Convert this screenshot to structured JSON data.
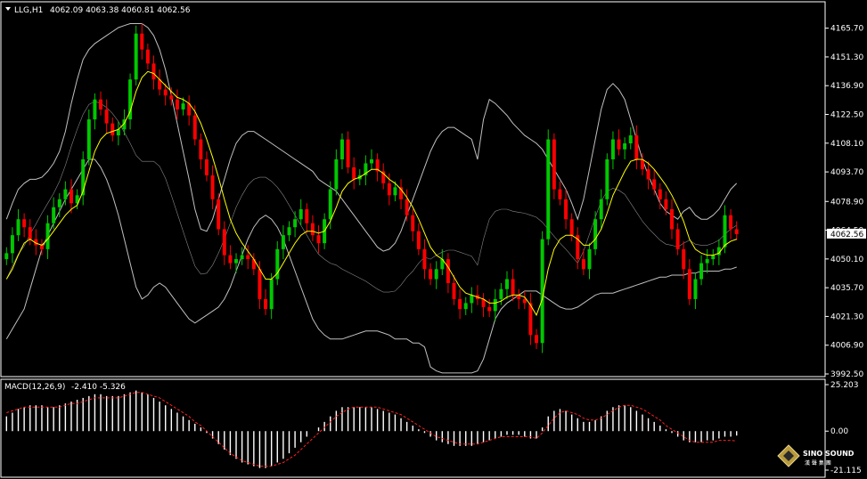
{
  "header": {
    "symbol": "LLG,H1",
    "ohlc": "4062.09 4063.38 4060.81 4062.56"
  },
  "macd_header": {
    "label": "MACD(12,26,9)",
    "values": "-2.410 -5.326"
  },
  "watermark": {
    "brand": "SINO SOUND",
    "sub": "漢 聲 集 團"
  },
  "colors": {
    "background": "#000000",
    "up_candle": "#00c800",
    "down_candle": "#ff0000",
    "ma": "#ffff00",
    "bollinger": "#c0c0c0",
    "macd_hist": "#ffffff",
    "macd_signal": "#ff2020",
    "axis_text": "#ffffff",
    "price_tag_bg": "#ffffff",
    "price_tag_text": "#000000"
  },
  "chart_data": [
    {
      "type": "candlestick",
      "title": "LLG,H1",
      "current_price": "4062.56",
      "ylim": [
        3992.5,
        4170
      ],
      "y_ticks": [
        "4165.70",
        "4151.30",
        "4136.90",
        "4122.50",
        "4108.10",
        "4093.70",
        "4078.90",
        "4064.50",
        "4050.10",
        "4035.70",
        "4021.30",
        "4006.90",
        "3992.50"
      ],
      "close": [
        4053,
        4062,
        4070,
        4066,
        4060,
        4057,
        4055,
        4068,
        4076,
        4080,
        4085,
        4078,
        4082,
        4100,
        4120,
        4130,
        4125,
        4118,
        4112,
        4115,
        4120,
        4140,
        4163,
        4155,
        4148,
        4140,
        4135,
        4132,
        4130,
        4125,
        4128,
        4122,
        4110,
        4100,
        4092,
        4080,
        4065,
        4052,
        4048,
        4050,
        4052,
        4050,
        4045,
        4030,
        4025,
        4040,
        4055,
        4062,
        4066,
        4070,
        4075,
        4068,
        4062,
        4058,
        4070,
        4085,
        4100,
        4110,
        4096,
        4090,
        4092,
        4098,
        4100,
        4094,
        4088,
        4082,
        4086,
        4080,
        4072,
        4064,
        4055,
        4045,
        4040,
        4045,
        4050,
        4038,
        4030,
        4025,
        4028,
        4032,
        4030,
        4026,
        4024,
        4030,
        4035,
        4040,
        4032,
        4030,
        4028,
        4012,
        4008,
        4060,
        4110,
        4085,
        4080,
        4070,
        4062,
        4050,
        4045,
        4055,
        4070,
        4080,
        4100,
        4110,
        4105,
        4108,
        4112,
        4100,
        4095,
        4090,
        4085,
        4080,
        4075,
        4065,
        4055,
        4045,
        4030,
        4040,
        4048,
        4050,
        4052,
        4056,
        4072,
        4065,
        4062.56
      ],
      "ma": [
        4040,
        4045,
        4052,
        4058,
        4060,
        4058,
        4057,
        4060,
        4064,
        4068,
        4072,
        4075,
        4077,
        4084,
        4094,
        4104,
        4110,
        4113,
        4114,
        4115,
        4118,
        4124,
        4134,
        4141,
        4144,
        4143,
        4140,
        4137,
        4134,
        4131,
        4130,
        4128,
        4124,
        4118,
        4110,
        4101,
        4091,
        4080,
        4070,
        4063,
        4058,
        4054,
        4050,
        4045,
        4040,
        4040,
        4043,
        4048,
        4053,
        4058,
        4062,
        4064,
        4064,
        4063,
        4064,
        4069,
        4076,
        4084,
        4088,
        4090,
        4091,
        4093,
        4095,
        4095,
        4093,
        4090,
        4088,
        4085,
        4081,
        4076,
        4070,
        4063,
        4056,
        4052,
        4050,
        4046,
        4041,
        4036,
        4033,
        4032,
        4031,
        4030,
        4028,
        4028,
        4029,
        4031,
        4032,
        4032,
        4031,
        4027,
        4022,
        4030,
        4045,
        4055,
        4060,
        4062,
        4062,
        4060,
        4057,
        4057,
        4060,
        4065,
        4073,
        4082,
        4088,
        4094,
        4099,
        4100,
        4100,
        4098,
        4095,
        4091,
        4087,
        4082,
        4076,
        4069,
        4060,
        4055,
        4053,
        4052,
        4052,
        4053,
        4057,
        4059,
        4060
      ],
      "bb_upper": [
        4070,
        4078,
        4085,
        4088,
        4090,
        4090,
        4091,
        4094,
        4098,
        4104,
        4114,
        4128,
        4140,
        4150,
        4155,
        4158,
        4160,
        4162,
        4164,
        4166,
        4167,
        4168,
        4168,
        4168,
        4166,
        4162,
        4155,
        4145,
        4132,
        4118,
        4104,
        4090,
        4075,
        4065,
        4064,
        4070,
        4080,
        4090,
        4100,
        4108,
        4112,
        4114,
        4114,
        4112,
        4110,
        4108,
        4106,
        4104,
        4102,
        4100,
        4098,
        4096,
        4094,
        4090,
        4088,
        4086,
        4084,
        4080,
        4076,
        4072,
        4068,
        4064,
        4060,
        4056,
        4054,
        4055,
        4058,
        4064,
        4072,
        4080,
        4088,
        4096,
        4104,
        4110,
        4114,
        4116,
        4116,
        4114,
        4112,
        4110,
        4100,
        4120,
        4130,
        4128,
        4125,
        4122,
        4118,
        4115,
        4112,
        4110,
        4108,
        4105,
        4100,
        4095,
        4090,
        4085,
        4078,
        4070,
        4080,
        4095,
        4110,
        4125,
        4135,
        4138,
        4135,
        4130,
        4120,
        4110,
        4100,
        4092,
        4085,
        4078,
        4074,
        4072,
        4070,
        4074,
        4076,
        4072,
        4070,
        4070,
        4072,
        4075,
        4080,
        4085,
        4088
      ],
      "bb_lower": [
        4010,
        4015,
        4020,
        4025,
        4035,
        4045,
        4055,
        4062,
        4068,
        4074,
        4080,
        4085,
        4090,
        4095,
        4100,
        4100,
        4096,
        4090,
        4082,
        4072,
        4060,
        4048,
        4036,
        4030,
        4032,
        4036,
        4038,
        4036,
        4032,
        4028,
        4024,
        4020,
        4018,
        4020,
        4022,
        4024,
        4026,
        4030,
        4036,
        4044,
        4052,
        4060,
        4066,
        4070,
        4072,
        4070,
        4066,
        4060,
        4052,
        4044,
        4036,
        4028,
        4020,
        4015,
        4012,
        4010,
        4010,
        4010,
        4011,
        4012,
        4013,
        4014,
        4014,
        4014,
        4013,
        4012,
        4010,
        4010,
        4010,
        4008,
        4008,
        4006,
        3996,
        3994,
        3993,
        3993,
        3993,
        3993,
        3993,
        3993,
        3994,
        4000,
        4010,
        4020,
        4025,
        4028,
        4030,
        4032,
        4034,
        4034,
        4034,
        4032,
        4030,
        4028,
        4026,
        4025,
        4025,
        4026,
        4028,
        4030,
        4032,
        4033,
        4033,
        4033,
        4034,
        4035,
        4036,
        4037,
        4038,
        4039,
        4040,
        4041,
        4041,
        4042,
        4042,
        4042,
        4043,
        4043,
        4044,
        4044,
        4044,
        4044,
        4045,
        4045,
        4046
      ]
    },
    {
      "type": "bar",
      "title": "MACD(12,26,9)",
      "y_ticks": [
        "25.203",
        "0.00",
        "-21.115"
      ],
      "ylim": [
        -21.115,
        25.203
      ],
      "histogram": [
        8,
        10,
        12,
        13,
        14,
        14,
        14,
        13,
        13,
        14,
        15,
        16,
        17,
        18,
        19,
        20,
        20,
        19,
        19,
        19,
        20,
        21,
        22,
        21,
        20,
        18,
        16,
        14,
        12,
        10,
        8,
        6,
        4,
        2,
        -1,
        -4,
        -7,
        -10,
        -13,
        -15,
        -17,
        -18,
        -19,
        -20,
        -20,
        -19,
        -17,
        -15,
        -12,
        -9,
        -6,
        -3,
        0,
        2,
        5,
        8,
        11,
        13,
        13,
        13,
        13,
        13,
        13,
        12,
        11,
        10,
        9,
        7,
        5,
        3,
        1,
        -1,
        -3,
        -5,
        -6,
        -7,
        -8,
        -8,
        -8,
        -8,
        -7,
        -6,
        -5,
        -4,
        -3,
        -2,
        -2,
        -2,
        -3,
        -4,
        -4,
        2,
        8,
        11,
        12,
        11,
        9,
        7,
        5,
        5,
        6,
        8,
        11,
        13,
        14,
        14,
        13,
        11,
        9,
        7,
        5,
        3,
        1,
        -1,
        -3,
        -5,
        -6,
        -6,
        -6,
        -5,
        -5,
        -4,
        -3,
        -3,
        -2.41
      ],
      "signal": [
        10,
        11,
        12,
        13,
        13,
        13,
        13,
        13,
        13,
        13,
        14,
        15,
        15,
        16,
        17,
        18,
        18,
        18,
        18,
        18,
        19,
        20,
        21,
        21,
        20,
        19,
        18,
        16,
        14,
        12,
        10,
        8,
        5,
        3,
        0,
        -3,
        -6,
        -9,
        -12,
        -14,
        -16,
        -17,
        -18,
        -19,
        -19,
        -19,
        -18,
        -17,
        -15,
        -13,
        -10,
        -7,
        -4,
        -1,
        2,
        5,
        8,
        10,
        12,
        13,
        13,
        13,
        13,
        13,
        12,
        11,
        10,
        9,
        7,
        5,
        3,
        1,
        -1,
        -3,
        -4,
        -5,
        -6,
        -7,
        -7,
        -7,
        -7,
        -6,
        -5,
        -4,
        -3,
        -3,
        -3,
        -3,
        -3,
        -3,
        -4,
        -1,
        3,
        7,
        10,
        11,
        10,
        9,
        7,
        6,
        6,
        7,
        9,
        11,
        13,
        14,
        14,
        13,
        12,
        10,
        8,
        6,
        3,
        1,
        -1,
        -3,
        -5,
        -6,
        -6,
        -6,
        -6,
        -5,
        -5,
        -5,
        -5.326
      ]
    }
  ]
}
